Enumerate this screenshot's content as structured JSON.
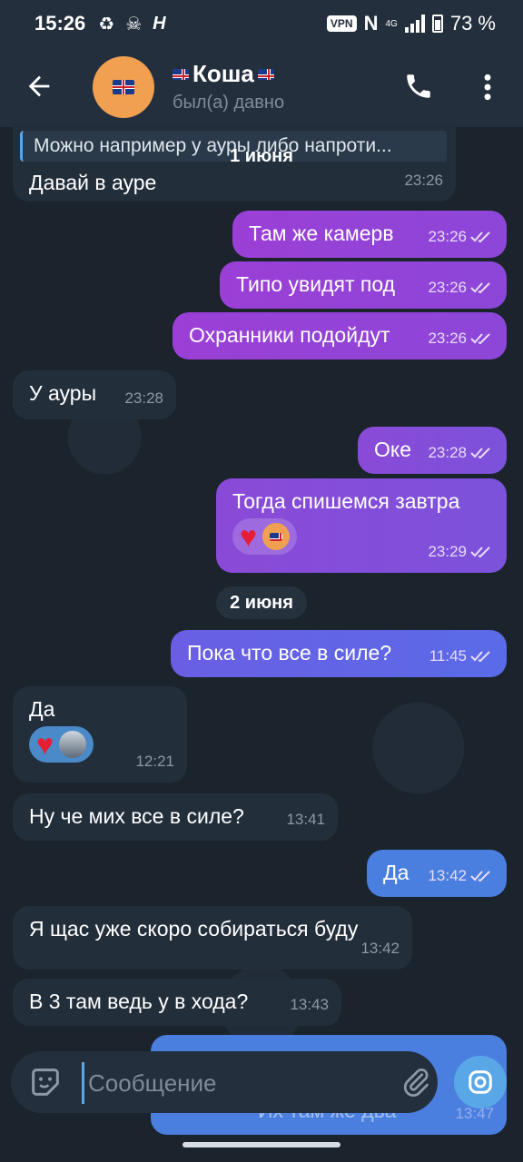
{
  "status_bar": {
    "time": "15:26",
    "vpn": "VPN",
    "net": "4G",
    "battery": "73 %"
  },
  "header": {
    "contact_name": "Коша",
    "status": "был(а) давно"
  },
  "colors": {
    "accent": "#5aa7e8",
    "incoming_bubble": "#232e3b",
    "outgoing_gradient_from": "#9b3fd6",
    "outgoing_gradient_to": "#5a6be8"
  },
  "messages": [
    {
      "dir": "in",
      "reply": "Можно например у ауры либо напроти...",
      "text": "Давай в ауре",
      "time": "23:26"
    },
    {
      "dir": "out",
      "text": "Там же камерв",
      "time": "23:26"
    },
    {
      "dir": "out",
      "text": "Типо увидят под",
      "time": "23:26"
    },
    {
      "dir": "out",
      "text": "Охранники подойдут",
      "time": "23:26"
    },
    {
      "dir": "in",
      "text": "У ауры",
      "time": "23:28"
    },
    {
      "dir": "out",
      "text": "Оке",
      "time": "23:28"
    },
    {
      "dir": "out",
      "text": "Тогда спишемся завтра",
      "time": "23:29"
    },
    {
      "dir": "out",
      "text": "Пока что все в силе?",
      "time": "11:45"
    },
    {
      "dir": "in",
      "text": "Да",
      "time": "12:21"
    },
    {
      "dir": "in",
      "text": "Ну че мих все в силе?",
      "time": "13:41"
    },
    {
      "dir": "out",
      "text": "Да",
      "time": "13:42"
    },
    {
      "dir": "in",
      "text": "Я щас уже скоро собираться буду",
      "time": "13:42"
    },
    {
      "dir": "in",
      "text": "В 3 там ведь у в хода?",
      "time": "13:43"
    },
    {
      "dir": "out",
      "text": "Их там же два",
      "time": "13:47"
    }
  ],
  "dates": [
    "1 июня",
    "2 июня"
  ],
  "input": {
    "placeholder": "Сообщение"
  }
}
